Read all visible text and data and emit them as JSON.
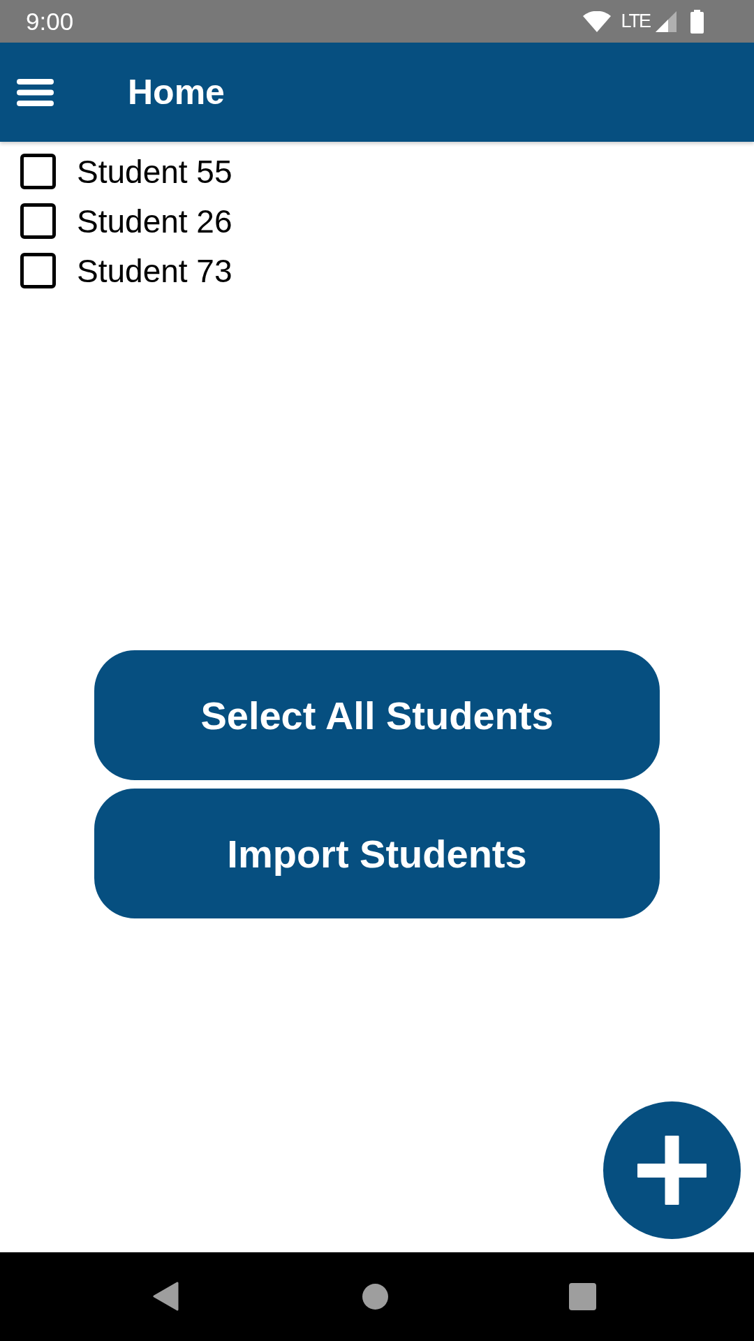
{
  "status_bar": {
    "time": "9:00",
    "network": "LTE"
  },
  "app_bar": {
    "title": "Home"
  },
  "students": [
    {
      "name": "Student 55",
      "checked": false
    },
    {
      "name": "Student 26",
      "checked": false
    },
    {
      "name": "Student 73",
      "checked": false
    }
  ],
  "buttons": [
    {
      "label": "Select All Students"
    },
    {
      "label": "Import Students"
    }
  ]
}
